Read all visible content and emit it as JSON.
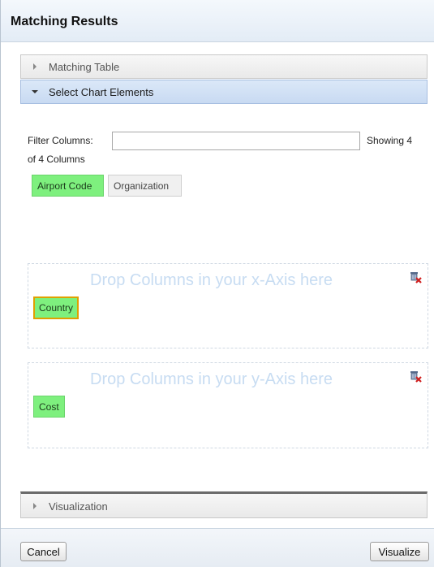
{
  "dialog": {
    "title": "Matching Results"
  },
  "accordion": {
    "matching_table": "Matching Table",
    "select_chart_elements": "Select Chart Elements",
    "visualization": "Visualization"
  },
  "filter": {
    "label": "Filter Columns:",
    "value": "",
    "showing_part1": "Showing 4",
    "showing_part2": "of 4 Columns"
  },
  "available_columns": [
    "Airport Code",
    "Organization"
  ],
  "x_axis": {
    "placeholder": "Drop Columns in your x-Axis here",
    "columns": [
      "Country"
    ]
  },
  "y_axis": {
    "placeholder": "Drop Columns in your y-Axis here",
    "columns": [
      "Cost"
    ]
  },
  "buttons": {
    "cancel": "Cancel",
    "visualize": "Visualize"
  },
  "colors": {
    "chip_green": "#7ef07e",
    "selected_border": "#e0a000",
    "active_header": "#c8daf2"
  },
  "icons": {
    "collapsed": "triangle-right-icon",
    "expanded": "triangle-down-icon",
    "clear": "trash-clear-icon"
  }
}
